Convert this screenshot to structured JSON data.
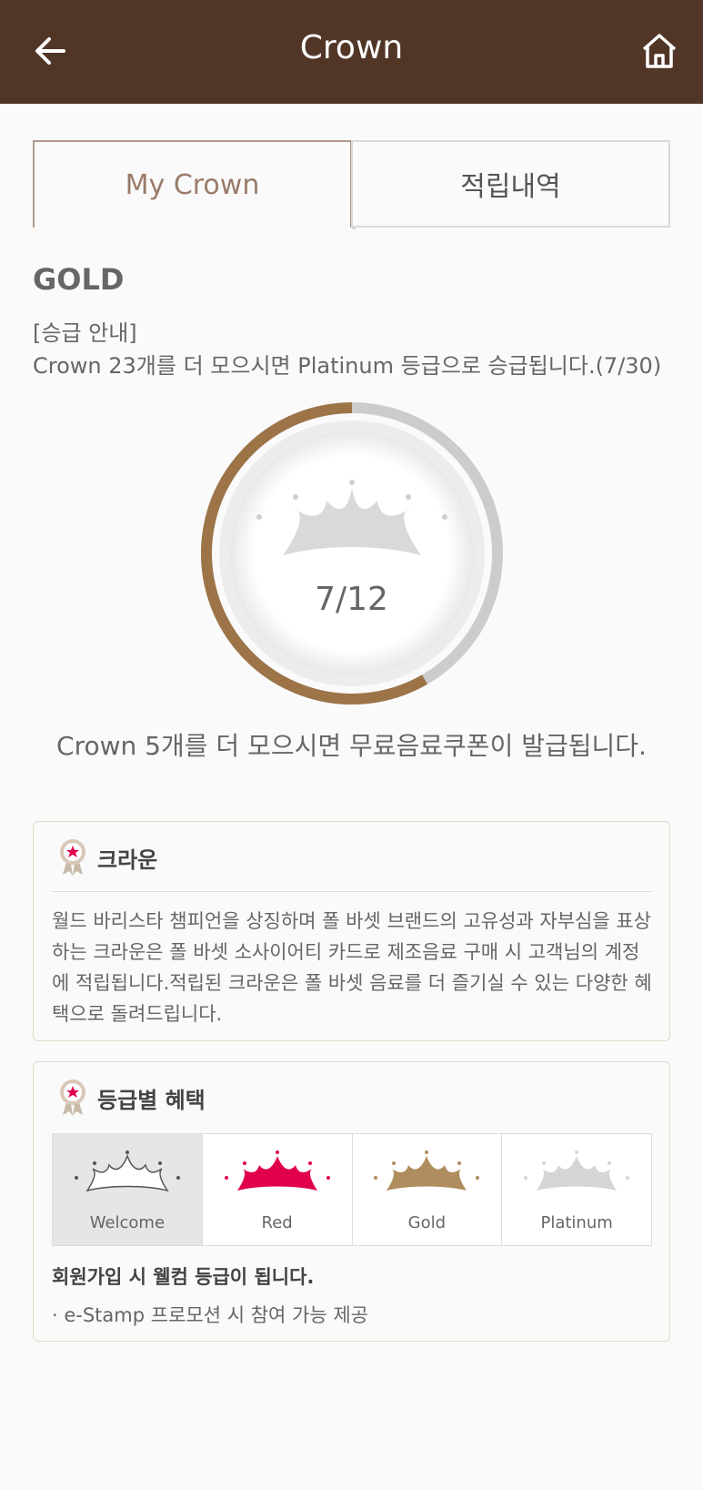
{
  "header": {
    "title": "Crown",
    "back_icon": "arrow-left-icon",
    "home_icon": "home-icon",
    "background": "#513627"
  },
  "tabs": [
    {
      "label": "My Crown",
      "active": true
    },
    {
      "label": "적립내역",
      "active": false
    }
  ],
  "grade": {
    "name": "GOLD",
    "guide_title": "[승급 안내]",
    "guide_text": "Crown 23개를 더 모으시면 Platinum 등급으로 승급됩니다.(7/30)"
  },
  "gauge": {
    "count_text": "7/12",
    "current": 7,
    "total": 12,
    "progress_color": "#9c7448",
    "track_color": "#cccccc",
    "icon": "crown-icon"
  },
  "notice": "Crown 5개를 더 모으시면 무료음료쿠폰이 발급됩니다.",
  "crown_card": {
    "title": "크라운",
    "icon": "award-badge-icon",
    "body": "월드 바리스타 챔피언을 상징하며 폴 바셋 브랜드의 고유성과 자부심을 표상하는 크라운은 폴 바셋 소사이어티 카드로 제조음료 구매 시 고객님의 계정에 적립됩니다.적립된 크라운은 폴 바셋 음료를 더 즐기실 수 있는 다양한 혜택으로 돌려드립니다."
  },
  "benefit_card": {
    "title": "등급별 혜택",
    "icon": "award-badge-icon",
    "grades": [
      {
        "label": "Welcome",
        "color": "#ffffff",
        "stroke": "#555555",
        "selected": true
      },
      {
        "label": "Red",
        "color": "#e0004d",
        "stroke": "#e0004d",
        "selected": false
      },
      {
        "label": "Gold",
        "color": "#b08d5e",
        "stroke": "#b08d5e",
        "selected": false
      },
      {
        "label": "Platinum",
        "color": "#d5d5d5",
        "stroke": "#d5d5d5",
        "selected": false
      }
    ],
    "description": "회원가입 시 웰컴 등급이 됩니다.",
    "bullet": "· e-Stamp 프로모션 시 참여 가능 제공"
  }
}
